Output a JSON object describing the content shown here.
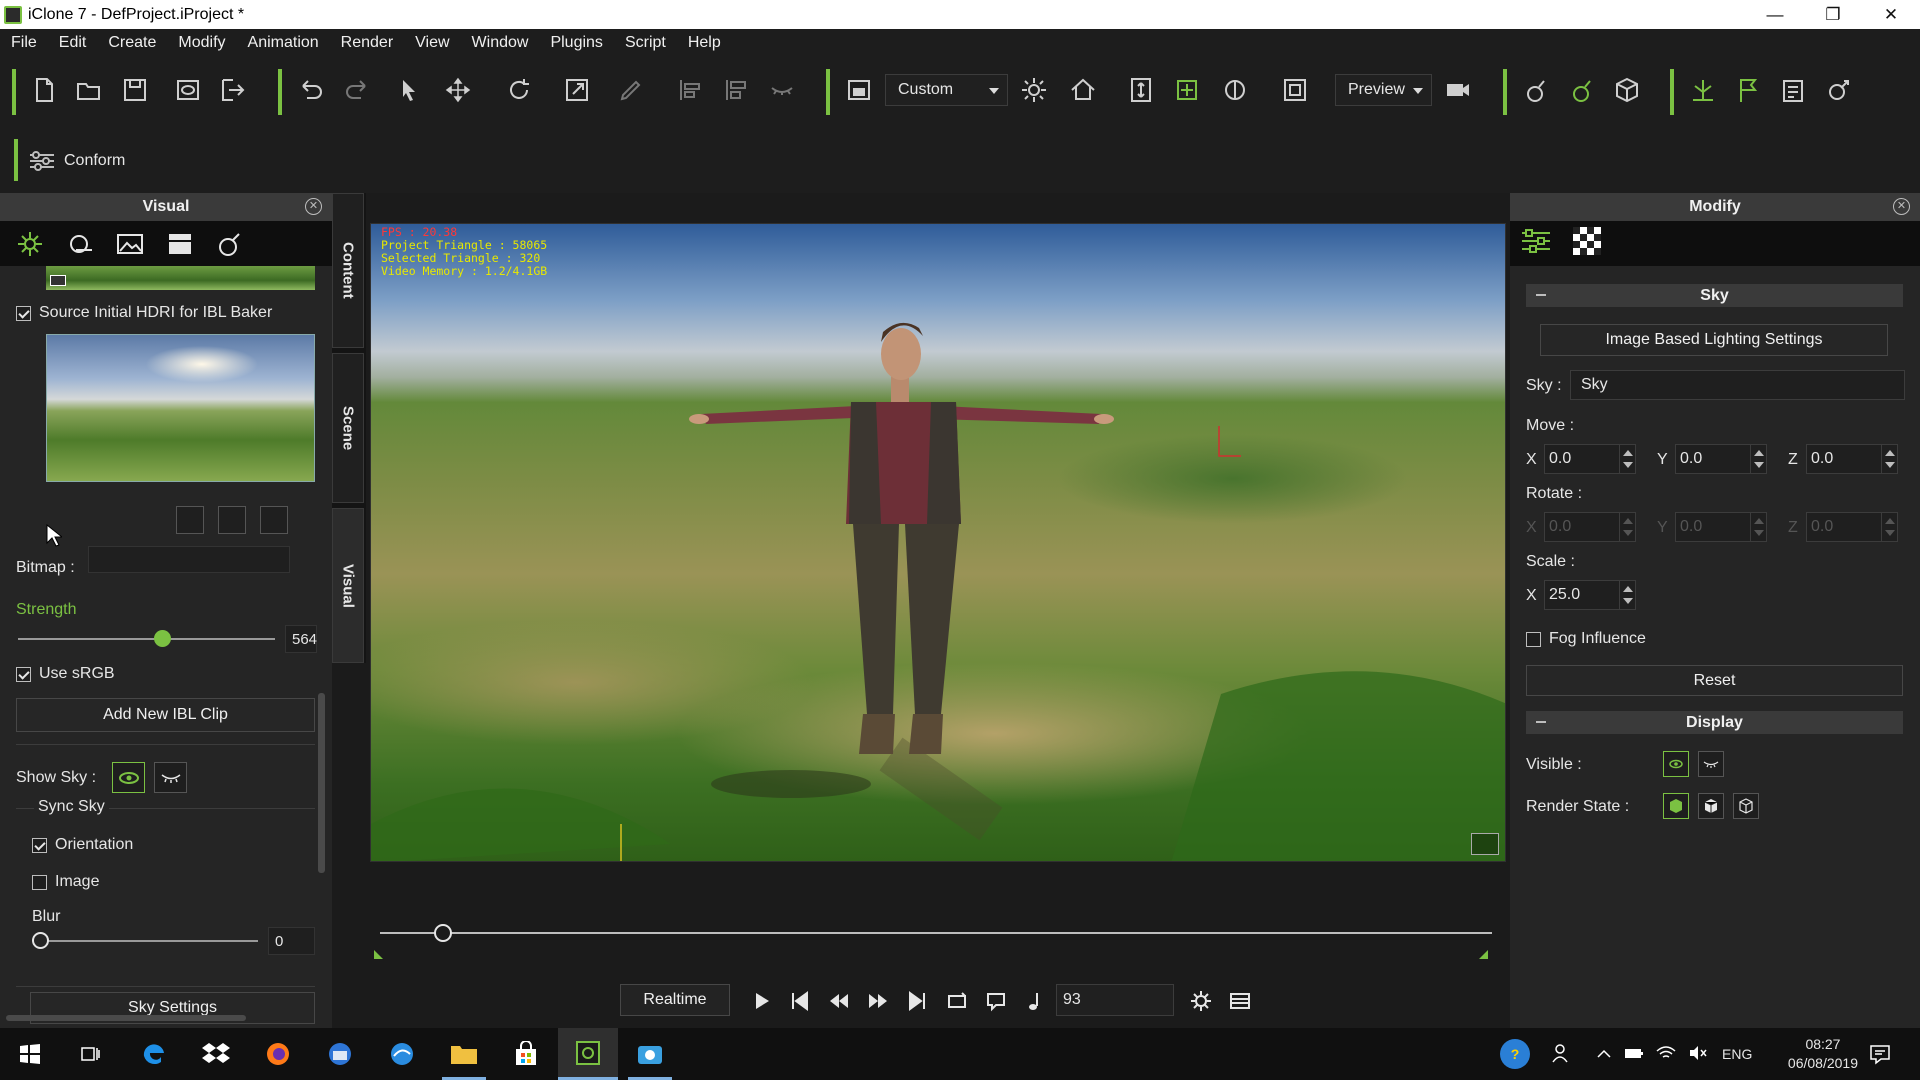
{
  "window": {
    "title": "iClone 7 - DefProject.iProject *",
    "minimize": "—",
    "restore": "❐",
    "close": "✕"
  },
  "menu": [
    "File",
    "Edit",
    "Create",
    "Modify",
    "Animation",
    "Render",
    "View",
    "Window",
    "Plugins",
    "Script",
    "Help"
  ],
  "toolbar": {
    "camera_combo": "Custom",
    "preview_combo": "Preview"
  },
  "subbar": {
    "conform_label": "Conform"
  },
  "left_panel": {
    "title": "Visual",
    "close": "✕",
    "source_hdri_label": "Source Initial HDRI for IBL Baker",
    "source_hdri_checked": true,
    "bitmap_label": "Bitmap :",
    "strength_label": "Strength",
    "strength_value": "564",
    "use_srgb_label": "Use sRGB",
    "use_srgb_checked": true,
    "add_ibl_clip": "Add New IBL Clip",
    "show_sky_label": "Show Sky :",
    "sync_sky_label": "Sync Sky",
    "orientation_label": "Orientation",
    "orientation_checked": true,
    "image_label": "Image",
    "image_checked": false,
    "blur_label": "Blur",
    "blur_value": "0",
    "sky_settings": "Sky Settings"
  },
  "side_tabs": [
    "Content",
    "Scene",
    "Visual"
  ],
  "viewport": {
    "fps": "FPS : 20.38",
    "project_triangle": "Project Triangle : 58065",
    "selected_triangle": "Selected Triangle : 320",
    "video_memory": "Video Memory : 1.2/4.1GB"
  },
  "timeline": {
    "realtime": "Realtime",
    "frame": "93"
  },
  "right_panel": {
    "title": "Modify",
    "close": "✕",
    "sky_section": "Sky",
    "ibl_settings": "Image Based Lighting Settings",
    "sky_label": "Sky :",
    "sky_value": "Sky",
    "move_label": "Move :",
    "move": {
      "x_label": "X",
      "x": "0.0",
      "y_label": "Y",
      "y": "0.0",
      "z_label": "Z",
      "z": "0.0"
    },
    "rotate_label": "Rotate :",
    "rotate": {
      "x_label": "X",
      "x": "0.0",
      "y_label": "Y",
      "y": "0.0",
      "z_label": "Z",
      "z": "0.0"
    },
    "scale_label": "Scale :",
    "scale": {
      "x_label": "X",
      "x": "25.0"
    },
    "fog_label": "Fog Influence",
    "fog_checked": false,
    "reset": "Reset",
    "display_section": "Display",
    "visible_label": "Visible :",
    "render_state_label": "Render State :"
  },
  "taskbar": {
    "language": "ENG",
    "time": "08:27",
    "date": "06/08/2019"
  },
  "colors": {
    "accent": "#7bc142",
    "hud_yellow": "#e8e800",
    "hud_red": "#ff3838",
    "panel": "#252525",
    "header": "#3a3a3a"
  }
}
